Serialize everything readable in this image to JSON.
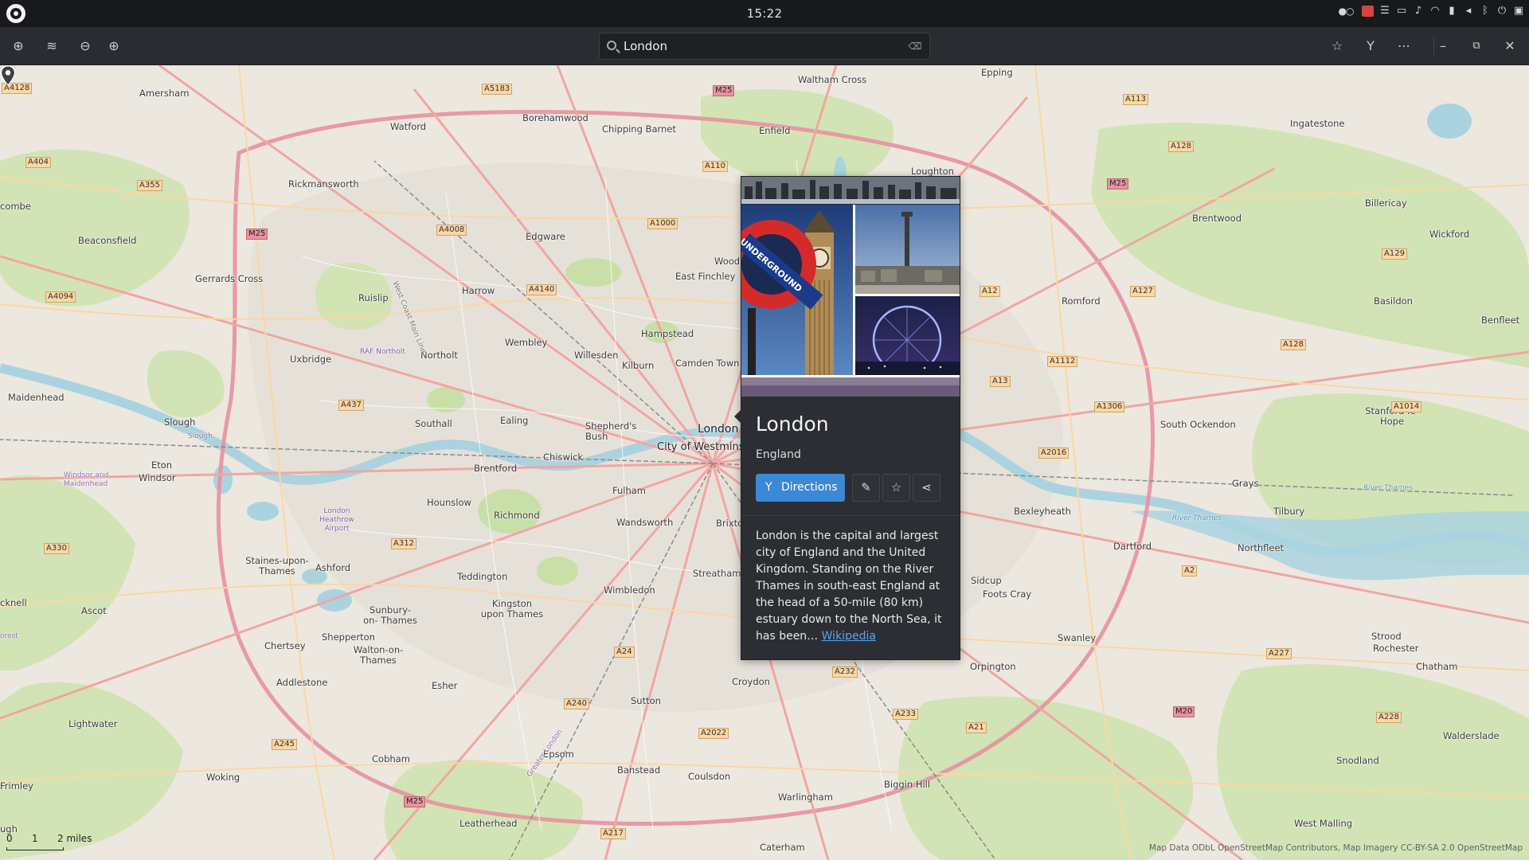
{
  "system_bar": {
    "clock": "15:22"
  },
  "header": {
    "search_value": "London",
    "icons": [
      "geolocate-icon",
      "layers-icon",
      "zoom-out-icon",
      "zoom-in-icon",
      "favourite-icon",
      "directions-icon",
      "menu-icon",
      "minimize-icon",
      "maximize-icon",
      "close-icon"
    ]
  },
  "map": {
    "places": {
      "amersham": "Amersham",
      "watford": "Watford",
      "borehamwood": "Borehamwood",
      "chipping_barnet": "Chipping Barnet",
      "enfield": "Enfield",
      "waltham_cross": "Waltham Cross",
      "epping": "Epping",
      "loughton": "Loughton",
      "ingatestone": "Ingatestone",
      "billericay": "Billericay",
      "brentwood": "Brentwood",
      "wickford": "Wickford",
      "rickmansworth": "Rickmansworth",
      "beaconsfield": "Beaconsfield",
      "gerrards_cross": "Gerrards Cross",
      "edgware": "Edgware",
      "east_finchley": "East Finchley",
      "wood": "Wood",
      "harrow": "Harrow",
      "ruislip": "Ruislip",
      "hampstead": "Hampstead",
      "camden_town": "Camden Town",
      "kilburn": "Kilburn",
      "willesden": "Willesden",
      "wembley": "Wembley",
      "northolt": "Northolt",
      "uxbridge": "Uxbridge",
      "raf_northolt": "RAF Northolt",
      "maidenhead": "Maidenhead",
      "slough": "Slough",
      "slough_small": "Slough",
      "southall": "Southall",
      "ealing": "Ealing",
      "shepherds_bush": "Shepherd's Bush",
      "london": "London",
      "city_of_westminster": "City of Westmins",
      "chiswick": "Chiswick",
      "brentford": "Brentford",
      "eton": "Eton",
      "windsor": "Windsor",
      "windsor_maidenhead": "Windsor and Maidenhead",
      "hounslow": "Hounslow",
      "richmond": "Richmond",
      "fulham": "Fulham",
      "wandsworth": "Wandsworth",
      "brixton": "Brixto",
      "heathrow": "London Heathrow Airport",
      "staines": "Staines-upon- Thames",
      "ashford": "Ashford",
      "teddington": "Teddington",
      "sunbury": "Sunbury-on- Thames",
      "kingston": "Kingston upon Thames",
      "wimbledon": "Wimbledon",
      "streatham": "Streatham",
      "ascot": "Ascot",
      "chertsey": "Chertsey",
      "shepperton": "Shepperton",
      "walton": "Walton-on- Thames",
      "addlestone": "Addlestone",
      "esher": "Esher",
      "sutton": "Sutton",
      "croydon": "Croydon",
      "lightwater": "Lightwater",
      "woking": "Woking",
      "cobham": "Cobham",
      "epsom": "Epsom",
      "banstead": "Banstead",
      "coulsdon": "Coulsdon",
      "leatherhead": "Leatherhead",
      "warlingham": "Warlingham",
      "caterham": "Caterham",
      "biggin_hill": "Biggin Hill",
      "orpington": "Orpington",
      "swanley": "Swanley",
      "sidcup": "Sidcup",
      "foots_cray": "Foots Cray",
      "bexleyheath": "Bexleyheath",
      "dartford": "Dartford",
      "romford": "Romford",
      "south_ockendon": "South Ockendon",
      "grays": "Grays",
      "tilbury": "Tilbury",
      "northfleet": "Northfleet",
      "basildon": "Basildon",
      "stanford": "Stanford-le- Hope",
      "benfleet": "Benfleet",
      "strood": "Strood",
      "rochester": "Rochester",
      "chatham": "Chatham",
      "snodland": "Snodland",
      "west_malling": "West Malling",
      "walderslade": "Walderslade",
      "frimley": "Frimley",
      "combe": "combe",
      "knell": "cknell",
      "ugh": "ugh",
      "river_thames": "River Thames",
      "river_thames2": "River Thames",
      "forest": "orest",
      "west_coast": "West Coast Main Line",
      "greater_london": "Greater London"
    },
    "roads": {
      "a4128": "A4128",
      "a5183": "A5183",
      "m25_n": "M25",
      "a110": "A110",
      "a113": "A113",
      "a128": "A128",
      "a404": "A404",
      "a355": "A355",
      "m25_w": "M25",
      "a4008": "A4008",
      "a1000": "A1000",
      "a4140": "A4140",
      "a4094": "A4094",
      "m25_ne": "M25",
      "a12": "A12",
      "a127": "A127",
      "a129": "A129",
      "a128b": "A128",
      "a1112": "A1112",
      "a13": "A13",
      "a1306": "A1306",
      "a1014": "A1014",
      "a2016": "A2016",
      "a437": "A437",
      "a330": "A330",
      "a312": "A312",
      "a24": "A24",
      "a240": "A240",
      "a232": "A232",
      "a233": "A233",
      "a21": "A21",
      "a2022": "A2022",
      "a245": "A245",
      "m25_s": "M25",
      "a217": "A217",
      "a2": "A2",
      "a227": "A227",
      "m20": "M20",
      "a228": "A228"
    },
    "scale": {
      "zero": "0",
      "one": "1",
      "two": "2 miles"
    },
    "attribution": "Map Data ODbL OpenStreetMap Contributors, Map Imagery CC-BY-SA 2.0 OpenStreetMap"
  },
  "popup": {
    "title": "London",
    "subtitle": "England",
    "directions_label": "Directions",
    "description": "London is the capital and largest city of England and the United Kingdom. Standing on the River Thames in south-east England at the head of a 50-mile (80 km) estuary down to the North Sea, it has been…",
    "link_label": "Wikipedia",
    "photo_sign_text": "UNDERGROUND"
  }
}
